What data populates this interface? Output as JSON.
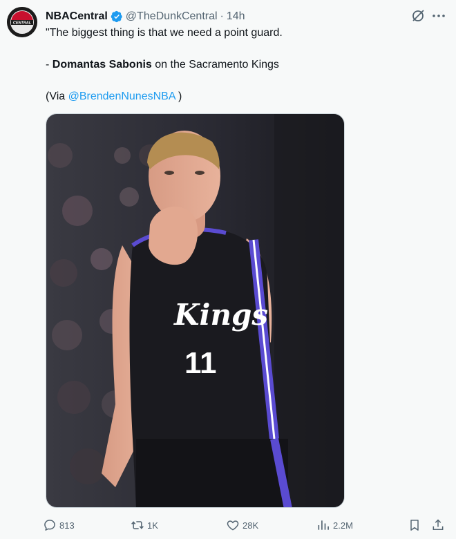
{
  "author": {
    "name": "NBACentral",
    "handle": "@TheDunkCentral",
    "separator": "·",
    "time": "14h",
    "avatar_text": "CENTRAL"
  },
  "tweet": {
    "line1": "\"The biggest thing is that we need a point guard.",
    "line2_prefix": "- ",
    "line2_bold": "Domantas Sabonis",
    "line2_suffix": " on the Sacramento Kings",
    "line3_prefix": "(Via ",
    "line3_link": "@BrendenNunesNBA",
    "line3_suffix": " )"
  },
  "media": {
    "jersey_text": "Kings",
    "jersey_number": "11"
  },
  "actions": {
    "replies": "813",
    "reposts": "1K",
    "likes": "28K",
    "views": "2.2M"
  },
  "icons": {
    "verified": "verified-badge-icon",
    "grok": "grok-icon",
    "more": "more-icon",
    "reply": "reply-icon",
    "repost": "repost-icon",
    "like": "heart-icon",
    "views": "views-chart-icon",
    "bookmark": "bookmark-icon",
    "share": "share-icon"
  },
  "colors": {
    "link": "#1d9bf0",
    "secondary_text": "#536471",
    "background": "#f7f9f9",
    "jersey_purple": "#5a4bd1"
  }
}
